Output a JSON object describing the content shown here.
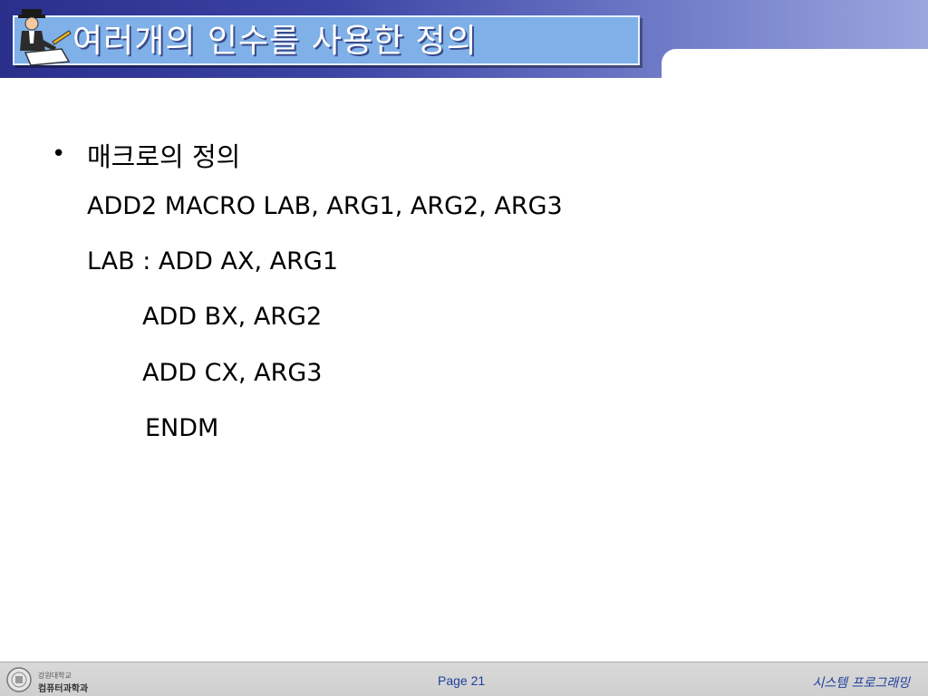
{
  "slide": {
    "title": "여러개의 인수를 사용한 정의",
    "icon": "person-writing-icon",
    "colors": {
      "header_start": "#2a2f8c",
      "header_end": "#9aa6de",
      "title_box": "#7fb0e8",
      "footer_text": "#1f3f9f"
    }
  },
  "body": {
    "bullet_symbol": "•",
    "heading": "매크로의 정의",
    "code_lines": [
      "ADD2 MACRO LAB, ARG1, ARG2, ARG3",
      "LAB : ADD AX, ARG1",
      "ADD BX, ARG2",
      "ADD CX, ARG3",
      "ENDM"
    ]
  },
  "footer": {
    "logo_line1": "강원대학교",
    "logo_line2": "컴퓨터과학과",
    "page": "Page 21",
    "course": "시스템 프로그래밍"
  }
}
